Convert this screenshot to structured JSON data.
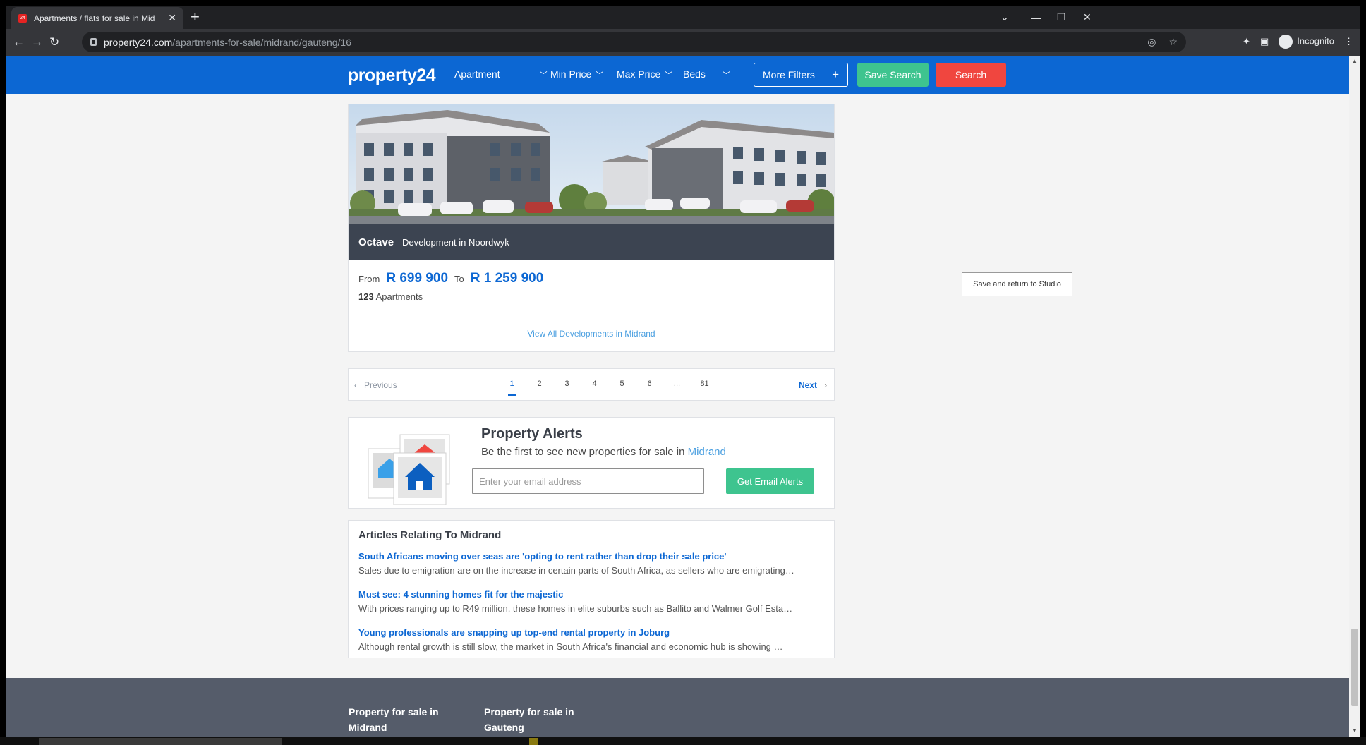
{
  "browser": {
    "tab_title": "Apartments / flats for sale in Mid",
    "new_tab": "+",
    "url_host": "property24.com",
    "url_path": "/apartments-for-sale/midrand/gauteng/16",
    "profile": "Incognito"
  },
  "header": {
    "logo": "property24",
    "property_type": "Apartment",
    "min_price": "Min Price",
    "max_price": "Max Price",
    "beds": "Beds",
    "more_filters": "More Filters",
    "save_search": "Save Search",
    "search": "Search",
    "colors": {
      "bar": "#0c67d3",
      "save": "#3ec48f",
      "search": "#f0463f"
    }
  },
  "development": {
    "name": "Octave",
    "subtitle": "Development in Noordwyk",
    "from_label": "From",
    "from_price": "R 699 900",
    "to_label": "To",
    "to_price": "R 1 259 900",
    "count": "123",
    "count_label": "Apartments",
    "view_all": "View All Developments in Midrand"
  },
  "pagination": {
    "previous": "Previous",
    "next": "Next",
    "pages": [
      "1",
      "2",
      "3",
      "4",
      "5",
      "6",
      "...",
      "81"
    ],
    "active": "1"
  },
  "alerts": {
    "title": "Property Alerts",
    "subtitle": "Be the first to see new properties for sale in",
    "location": "Midrand",
    "email_placeholder": "Enter your email address",
    "button": "Get Email Alerts"
  },
  "articles": {
    "title": "Articles Relating To Midrand",
    "items": [
      {
        "headline": "South Africans moving over seas are 'opting to rent rather than drop their sale price'",
        "desc": "Sales due to emigration are on the increase in certain parts of South Africa, as sellers who are emigrating…"
      },
      {
        "headline": "Must see: 4 stunning homes fit for the majestic",
        "desc": "With prices ranging up to R49 million, these homes in elite suburbs such as Ballito and Walmer Golf Esta…"
      },
      {
        "headline": "Young professionals are snapping up top-end rental property in Joburg",
        "desc": "Although rental growth is still slow, the market in South Africa's financial and economic hub is showing …"
      }
    ]
  },
  "studio_button": "Save and return to Studio",
  "footer": {
    "col1": "Property for sale in Midrand",
    "col2": "Property for sale in Gauteng"
  }
}
